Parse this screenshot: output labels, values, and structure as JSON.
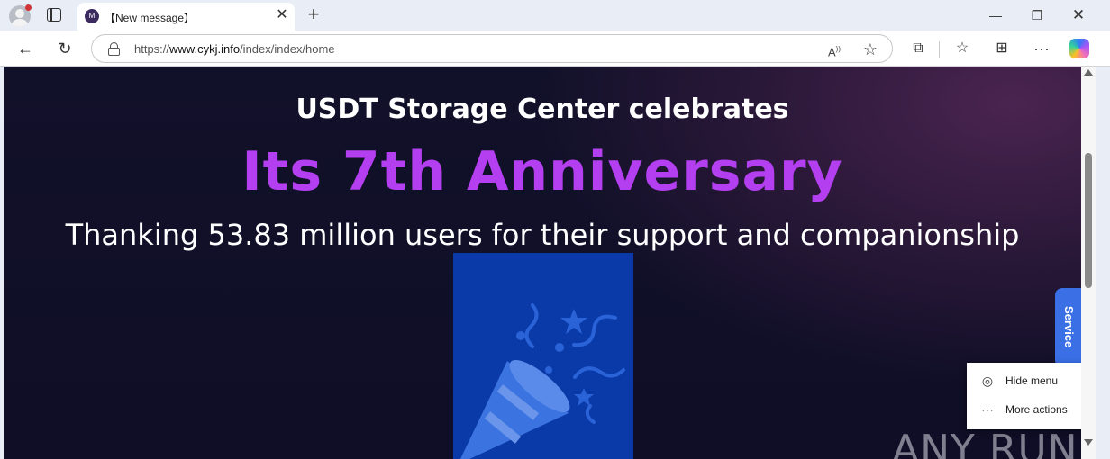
{
  "browser": {
    "tab_title": "【New message】",
    "favicon_letter": "M",
    "url_domain": "www.cykj.info",
    "url_prefix": "https://",
    "url_path": "/index/index/home"
  },
  "page": {
    "headline_top": "USDT Storage Center celebrates",
    "headline_main": "Its 7th Anniversary",
    "subheadline": "Thanking 53.83 million users for their support and companionship",
    "service_label": "Service",
    "watermark": "ANY RUN",
    "accent_color": "#b43ff0"
  },
  "context_menu": {
    "items": [
      {
        "label": "Hide menu",
        "icon": "eye-off-icon"
      },
      {
        "label": "More actions",
        "icon": "more-icon"
      }
    ]
  }
}
